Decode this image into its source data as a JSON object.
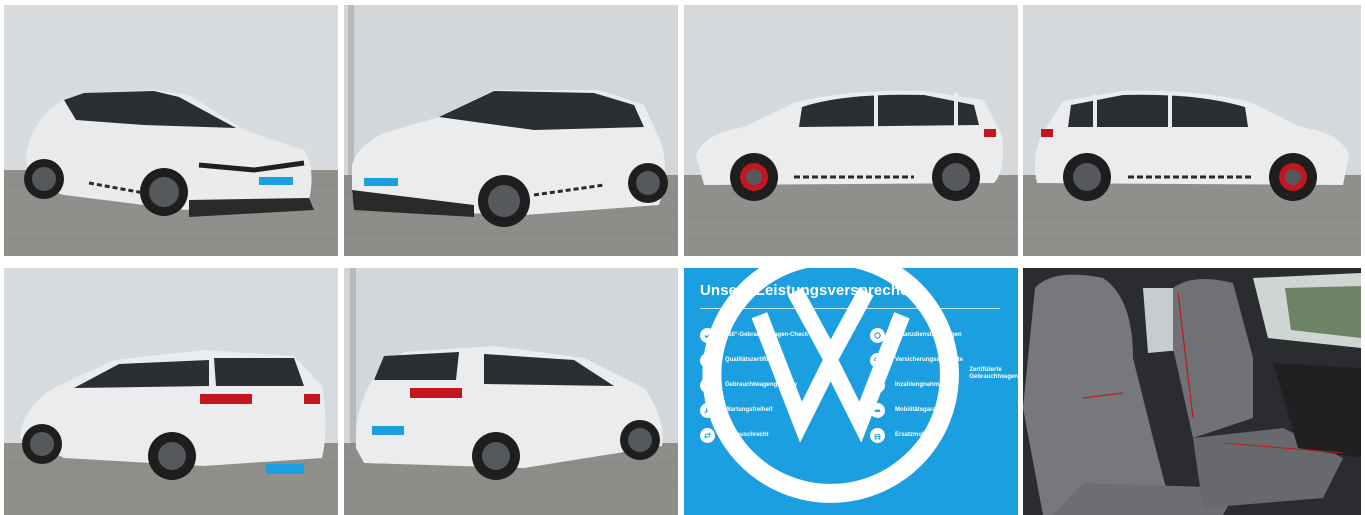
{
  "gallery": {
    "photos": [
      {
        "icon": "car-front-left-photo"
      },
      {
        "icon": "car-front-right-photo"
      },
      {
        "icon": "car-side-left-photo"
      },
      {
        "icon": "car-side-right-photo"
      },
      {
        "icon": "car-rear-right-photo"
      },
      {
        "icon": "car-rear-left-photo"
      },
      {
        "icon": "car-interior-seats-photo"
      }
    ],
    "car_color": "#e9ebed",
    "accent_red": "#c4161c"
  },
  "promise": {
    "title": "Unsere Leistungsversprechen",
    "background": "#1b9fe0",
    "left_items": [
      {
        "label": "360°-Gebrauchtwagen-Check",
        "icon": "check-icon"
      },
      {
        "label": "Qualitätszertifikat",
        "icon": "certificate-icon"
      },
      {
        "label": "Gebrauchtwagengarantie",
        "icon": "shield-icon"
      },
      {
        "label": "Wartungsfreiheit",
        "icon": "wrench-icon"
      },
      {
        "label": "Umtauschrecht",
        "icon": "exchange-icon"
      }
    ],
    "right_items": [
      {
        "label": "Finanzdienstleistungen",
        "icon": "finance-icon"
      },
      {
        "label": "Versicherungsangebote",
        "icon": "umbrella-icon"
      },
      {
        "label": "Inzahlungnahme",
        "icon": "car-tradein-icon"
      },
      {
        "label": "Mobilitätsgarantie",
        "icon": "car-assist-icon"
      },
      {
        "label": "Ersatzmobilität",
        "icon": "replacement-car-icon"
      }
    ],
    "footer_line1": "Zertifizierte",
    "footer_line2": "Gebrauchtwagen",
    "logo": "vw-logo-icon"
  }
}
